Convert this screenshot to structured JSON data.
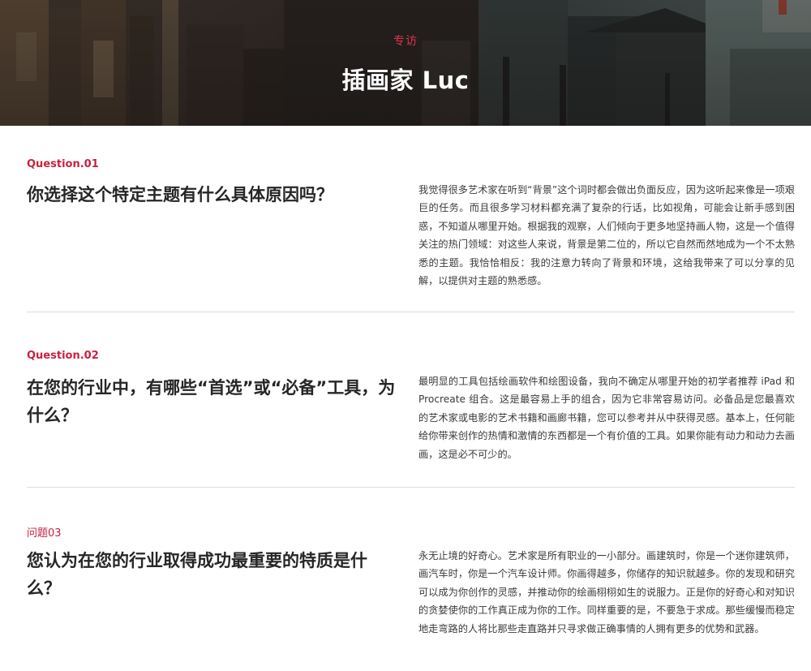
{
  "hero": {
    "tag": "专访",
    "title": "插画家 Luc"
  },
  "sections": [
    {
      "label": "Question.01",
      "question": "你选择这个特定主题有什么具体原因吗？",
      "answer": "我觉得很多艺术家在听到“背景”这个词时都会做出负面反应，因为这听起来像是一项艰巨的任务。而且很多学习材料都充满了复杂的行话，比如视角，可能会让新手感到困惑，不知道从哪里开始。根据我的观察，人们倾向于更多地坚持画人物，这是一个值得关注的热门领域：对这些人来说，背景是第二位的，所以它自然而然地成为一个不太熟悉的主题。我恰恰相反：我的注意力转向了背景和环境，这给我带来了可以分享的见解，以提供对主题的熟悉感。"
    },
    {
      "label": "Question.02",
      "question": "在您的行业中，有哪些“首选”或“必备”工具，为什么？",
      "answer": "最明显的工具包括绘画软件和绘图设备，我向不确定从哪里开始的初学者推荐 iPad 和 Procreate 组合。这是最容易上手的组合，因为它非常容易访问。必备品是您最喜欢的艺术家或电影的艺术书籍和画廊书籍，您可以参考并从中获得灵感。基本上，任何能给你带来创作的热情和激情的东西都是一个有价值的工具。如果你能有动力和动力去画画，这是必不可少的。"
    },
    {
      "label": "问题03",
      "question": "您认为在您的行业取得成功最重要的特质是什么？",
      "answer": "永无止境的好奇心。艺术家是所有职业的一小部分。画建筑时，你是一个迷你建筑师，画汽车时，你是一个汽车设计师。你画得越多，你储存的知识就越多。你的发现和研究可以成为你创作的灵感，并推动你的绘画栩栩如生的说服力。正是你的好奇心和对知识的贪婪使你的工作真正成为你的工作。同样重要的是，不要急于求成。那些缓慢而稳定地走弯路的人将比那些走直路并只寻求做正确事情的人拥有更多的优势和武器。"
    }
  ],
  "colors": {
    "accent": "#c8213f",
    "tag": "#e0344f",
    "divider": "#dcdcdc"
  }
}
